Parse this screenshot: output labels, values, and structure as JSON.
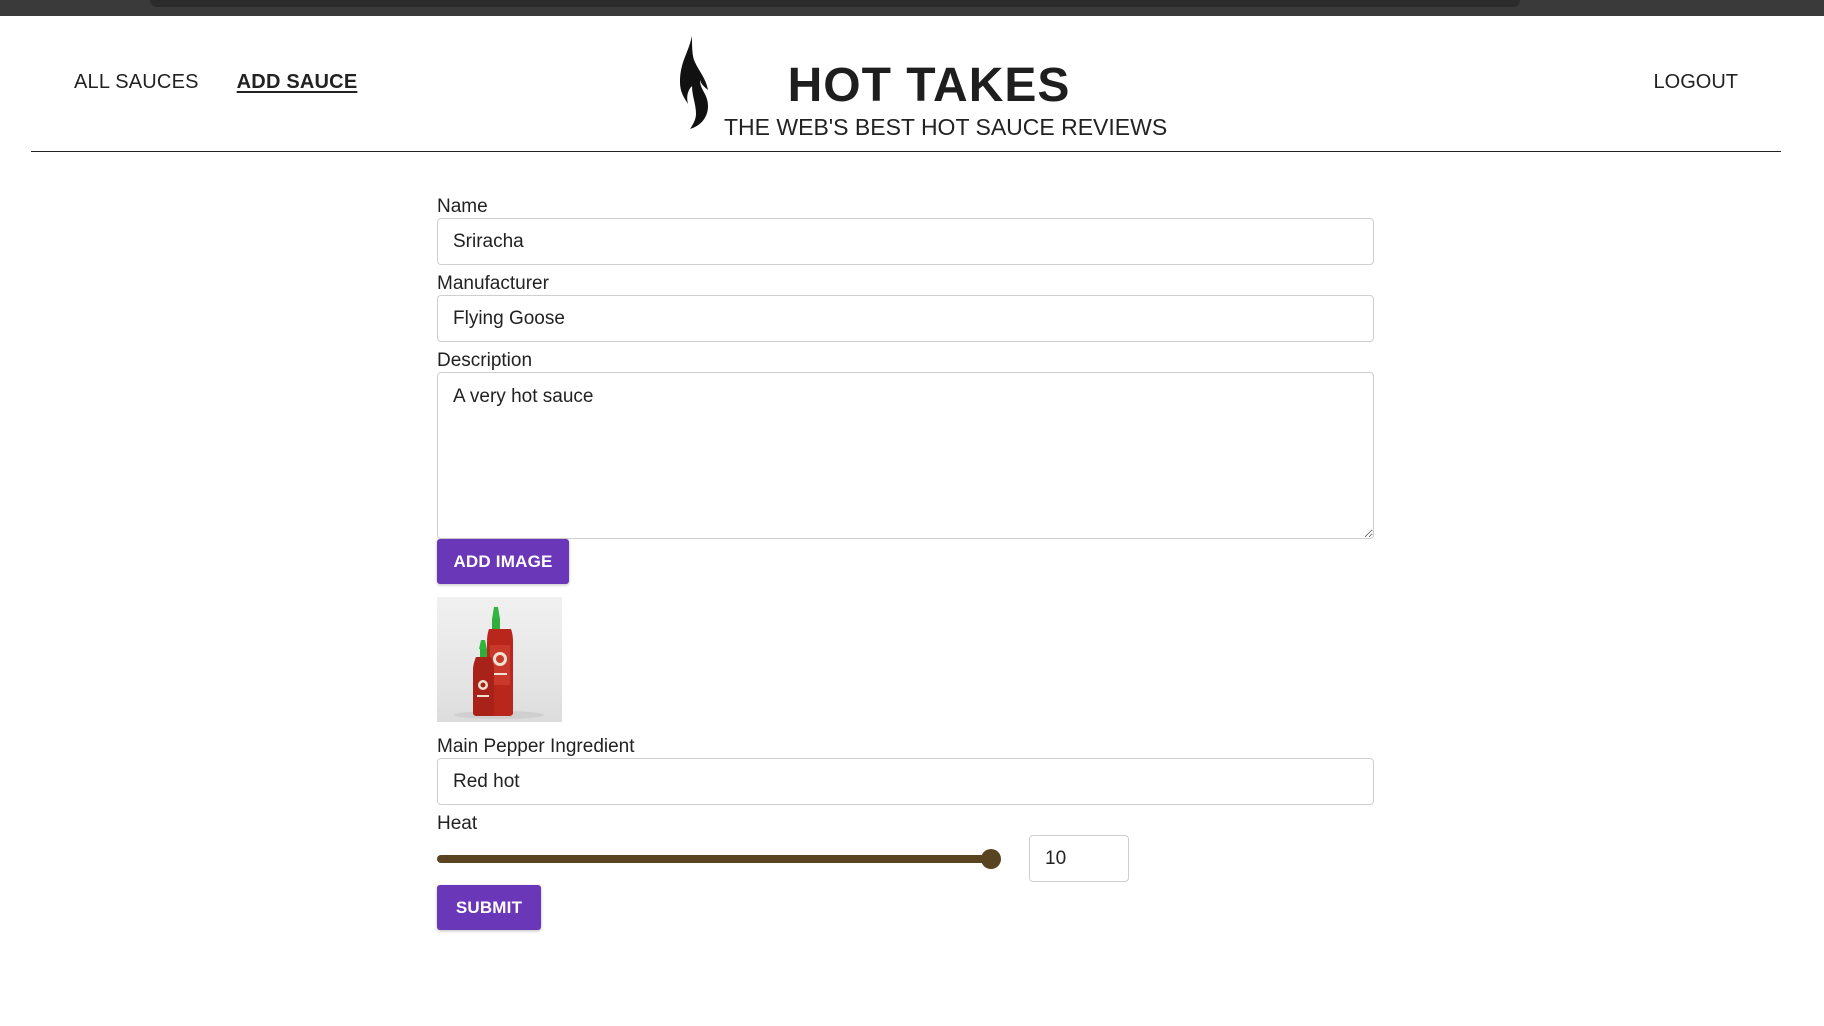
{
  "nav": {
    "all_sauces": "ALL SAUCES",
    "add_sauce": "ADD SAUCE",
    "logout": "LOGOUT"
  },
  "brand": {
    "title": "HOT TAKES",
    "subtitle": "THE WEB'S BEST HOT SAUCE REVIEWS",
    "logo_icon": "flame-icon"
  },
  "form": {
    "name": {
      "label": "Name",
      "value": "Sriracha"
    },
    "manufacturer": {
      "label": "Manufacturer",
      "value": "Flying Goose"
    },
    "description": {
      "label": "Description",
      "value": "A very hot sauce"
    },
    "add_image_label": "ADD IMAGE",
    "image_preview": "sriracha-bottles-image",
    "main_pepper": {
      "label": "Main Pepper Ingredient",
      "value": "Red hot"
    },
    "heat": {
      "label": "Heat",
      "value": "10",
      "min": 1,
      "max": 10
    },
    "submit_label": "SUBMIT"
  },
  "colors": {
    "accent": "#6a37b8",
    "slider": "#5a4320",
    "text": "#222222"
  }
}
